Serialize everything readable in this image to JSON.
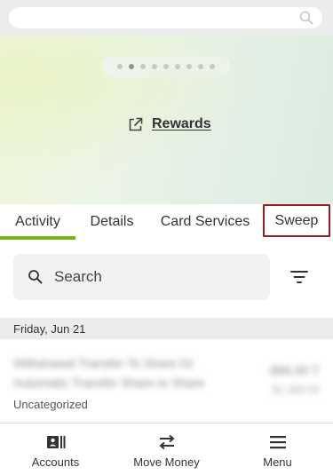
{
  "top_search": {
    "icon": "search-icon"
  },
  "carousel": {
    "dot_count": 9,
    "active_index": 1
  },
  "rewards": {
    "label": "Rewards",
    "icon": "external-link-icon"
  },
  "tabs": [
    {
      "label": "Activity",
      "active": true
    },
    {
      "label": "Details"
    },
    {
      "label": "Card Services"
    },
    {
      "label": "Sweep",
      "highlighted": true
    }
  ],
  "search": {
    "placeholder": "Search",
    "icon": "search-icon",
    "filter_icon": "filter-icon"
  },
  "activity": {
    "date_header": "Friday, Jun 21",
    "transactions": [
      {
        "description": "Withdrawal Transfer To Share 01 Automatic Transfer Share to Share",
        "amount": "-$96.90 T",
        "balance": "$1,389.00",
        "category": "Uncategorized"
      }
    ]
  },
  "bottom_nav": [
    {
      "label": "Accounts",
      "icon": "accounts-icon"
    },
    {
      "label": "Move Money",
      "icon": "transfer-arrows-icon"
    },
    {
      "label": "Menu",
      "icon": "hamburger-menu-icon"
    }
  ],
  "colors": {
    "accent": "#7cb518",
    "highlight_border": "#9b1c1c"
  }
}
